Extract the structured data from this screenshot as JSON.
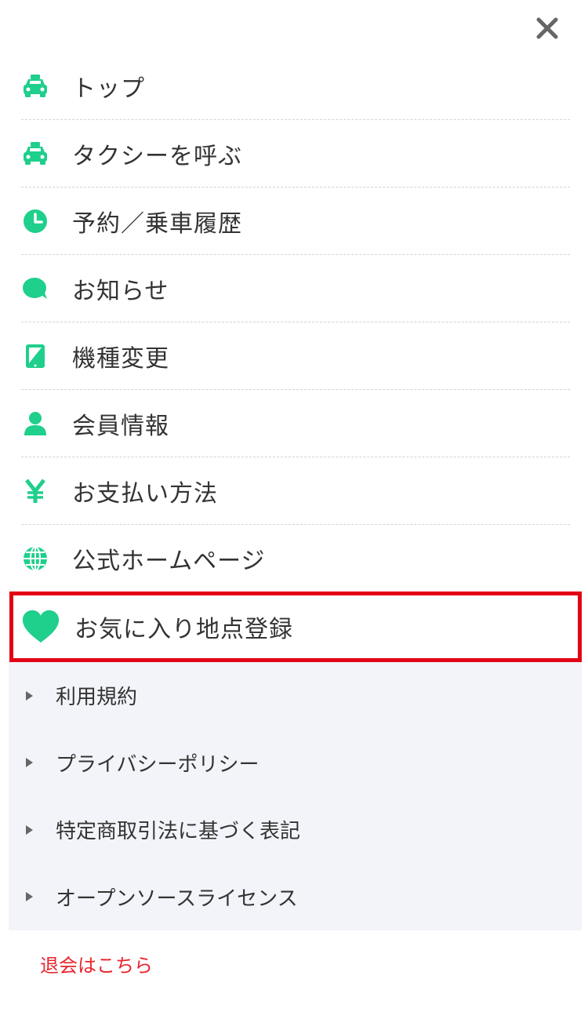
{
  "colors": {
    "accent": "#1fcf8c",
    "highlight_border": "#e30014",
    "withdraw_text": "#e8252e",
    "sub_background": "#f3f4f9"
  },
  "close": {
    "icon": "close-icon"
  },
  "menu": {
    "items": [
      {
        "icon": "taxi-icon",
        "label": "トップ"
      },
      {
        "icon": "taxi-icon",
        "label": "タクシーを呼ぶ"
      },
      {
        "icon": "clock-icon",
        "label": "予約／乗車履歴"
      },
      {
        "icon": "speech-bubble-icon",
        "label": "お知らせ"
      },
      {
        "icon": "tablet-icon",
        "label": "機種変更"
      },
      {
        "icon": "user-icon",
        "label": "会員情報"
      },
      {
        "icon": "yen-icon",
        "label": "お支払い方法"
      },
      {
        "icon": "globe-icon",
        "label": "公式ホームページ"
      }
    ]
  },
  "favorite": {
    "icon": "heart-icon",
    "label": "お気に入り地点登録"
  },
  "sub_links": [
    {
      "label": "利用規約"
    },
    {
      "label": "プライバシーポリシー"
    },
    {
      "label": "特定商取引法に基づく表記"
    },
    {
      "label": "オープンソースライセンス"
    }
  ],
  "withdraw": {
    "label": "退会はこちら"
  }
}
